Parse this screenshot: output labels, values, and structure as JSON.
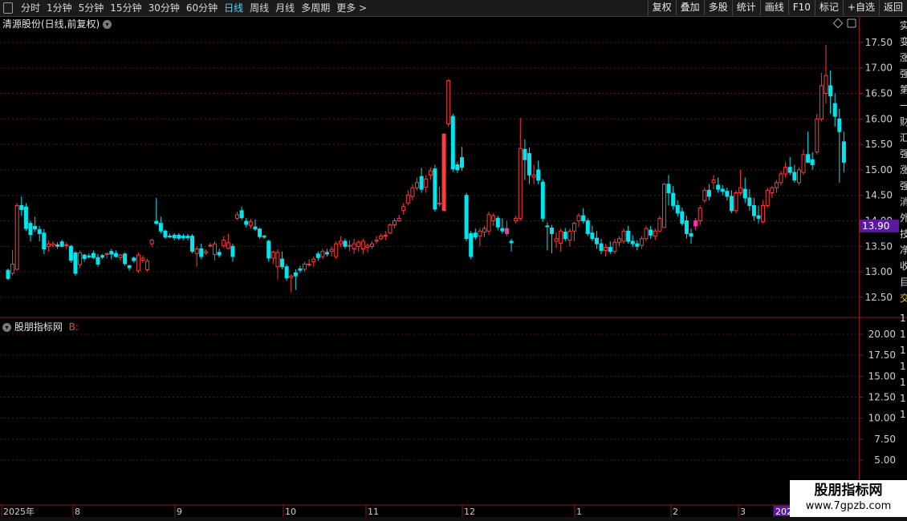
{
  "toolbar": {
    "periods": [
      "分时",
      "1分钟",
      "5分钟",
      "15分钟",
      "30分钟",
      "60分钟",
      "日线",
      "周线",
      "月线",
      "多周期",
      "更多 >"
    ],
    "active_period": "日线",
    "right_buttons": [
      "复权",
      "叠加",
      "多股",
      "统计",
      "画线",
      "F10",
      "标记",
      "+自选",
      "返回"
    ]
  },
  "main_title": "清源股份(日线,前复权)",
  "indicator_title": "股朋指标网",
  "indicator_suffix": "B:",
  "current_price_tag": "13.90",
  "main_axis": [
    "17.50",
    "17.00",
    "16.50",
    "16.00",
    "15.50",
    "15.00",
    "14.50",
    "14.00",
    "13.50",
    "13.00",
    "12.50"
  ],
  "indicator_axis": [
    "20.00",
    "17.50",
    "15.00",
    "12.50",
    "10.00",
    "7.50",
    "5.00"
  ],
  "date_axis": [
    "2025年",
    "8",
    "9",
    "10",
    "11",
    "12",
    "1",
    "2",
    "3",
    "202"
  ],
  "right_edge_glyphs": [
    "实",
    "变",
    "涨",
    "强",
    "第",
    "一",
    "财",
    "汇",
    "强",
    "涨",
    "强",
    "消",
    "外",
    "技",
    "净",
    "收",
    "目",
    "交",
    "1",
    "1",
    "1",
    "1",
    "1",
    "1",
    "1"
  ],
  "watermark": {
    "line1": "股朋指标网",
    "line2": "www.7gpzb.com"
  },
  "colors": {
    "up": "#ff3a3a",
    "down": "#00e6f0",
    "highlight": "#ff2fa8",
    "grid": "#5a1414",
    "price_tag_bg": "#5a1aa0"
  },
  "chart_data": {
    "type": "candlestick",
    "ylim": [
      12.2,
      17.75
    ],
    "candles": [
      {
        "o": 13.03,
        "h": 13.06,
        "l": 12.83,
        "c": 12.87
      },
      {
        "o": 12.97,
        "h": 13.43,
        "l": 12.93,
        "c": 13.15
      },
      {
        "o": 13.05,
        "h": 14.35,
        "l": 13.03,
        "c": 14.3
      },
      {
        "o": 14.3,
        "h": 14.48,
        "l": 14.1,
        "c": 14.22
      },
      {
        "o": 14.27,
        "h": 14.35,
        "l": 13.8,
        "c": 13.85
      },
      {
        "o": 13.95,
        "h": 14.0,
        "l": 13.6,
        "c": 13.73
      },
      {
        "o": 13.89,
        "h": 14.08,
        "l": 13.78,
        "c": 13.84
      },
      {
        "o": 13.83,
        "h": 13.9,
        "l": 13.6,
        "c": 13.75
      },
      {
        "o": 13.76,
        "h": 13.84,
        "l": 13.35,
        "c": 13.45
      },
      {
        "o": 13.5,
        "h": 13.62,
        "l": 13.4,
        "c": 13.55
      },
      {
        "o": 13.52,
        "h": 13.6,
        "l": 13.48,
        "c": 13.55
      },
      {
        "o": 13.53,
        "h": 13.58,
        "l": 13.45,
        "c": 13.5
      },
      {
        "o": 13.59,
        "h": 13.63,
        "l": 13.48,
        "c": 13.5
      },
      {
        "o": 13.53,
        "h": 13.58,
        "l": 13.45,
        "c": 13.53
      },
      {
        "o": 13.5,
        "h": 13.53,
        "l": 13.18,
        "c": 13.23
      },
      {
        "o": 13.37,
        "h": 13.41,
        "l": 12.92,
        "c": 12.97
      },
      {
        "o": 13.14,
        "h": 13.42,
        "l": 13.07,
        "c": 13.37
      },
      {
        "o": 13.33,
        "h": 13.35,
        "l": 13.2,
        "c": 13.26
      },
      {
        "o": 13.31,
        "h": 13.36,
        "l": 13.27,
        "c": 13.3
      },
      {
        "o": 13.36,
        "h": 13.42,
        "l": 13.25,
        "c": 13.28
      },
      {
        "o": 13.28,
        "h": 13.35,
        "l": 13.1,
        "c": 13.15
      },
      {
        "o": 13.32,
        "h": 13.35,
        "l": 13.25,
        "c": 13.29
      },
      {
        "o": 13.34,
        "h": 13.38,
        "l": 13.26,
        "c": 13.36
      },
      {
        "o": 13.4,
        "h": 13.45,
        "l": 13.25,
        "c": 13.35
      },
      {
        "o": 13.36,
        "h": 13.42,
        "l": 13.28,
        "c": 13.3
      },
      {
        "o": 13.28,
        "h": 13.35,
        "l": 13.22,
        "c": 13.33
      },
      {
        "o": 13.35,
        "h": 13.38,
        "l": 13.12,
        "c": 13.16
      },
      {
        "o": 13.12,
        "h": 13.14,
        "l": 13.02,
        "c": 13.08
      },
      {
        "o": 13.27,
        "h": 13.3,
        "l": 13.18,
        "c": 13.22
      },
      {
        "o": 13.02,
        "h": 13.38,
        "l": 12.98,
        "c": 13.33
      },
      {
        "o": 13.23,
        "h": 13.32,
        "l": 13.18,
        "c": 13.27
      },
      {
        "o": 13.04,
        "h": 13.26,
        "l": 13.0,
        "c": 13.21
      },
      {
        "o": 13.55,
        "h": 13.65,
        "l": 13.48,
        "c": 13.62
      },
      {
        "o": 13.99,
        "h": 14.45,
        "l": 13.92,
        "c": 13.95
      },
      {
        "o": 13.95,
        "h": 14.08,
        "l": 13.75,
        "c": 13.8
      },
      {
        "o": 13.8,
        "h": 13.83,
        "l": 13.65,
        "c": 13.68
      },
      {
        "o": 13.7,
        "h": 13.75,
        "l": 13.66,
        "c": 13.69
      },
      {
        "o": 13.72,
        "h": 13.76,
        "l": 13.62,
        "c": 13.67
      },
      {
        "o": 13.72,
        "h": 13.76,
        "l": 13.62,
        "c": 13.66
      },
      {
        "o": 13.7,
        "h": 13.74,
        "l": 13.62,
        "c": 13.67
      },
      {
        "o": 13.7,
        "h": 13.74,
        "l": 13.62,
        "c": 13.67
      },
      {
        "o": 13.7,
        "h": 13.74,
        "l": 13.36,
        "c": 13.4
      },
      {
        "o": 13.36,
        "h": 13.5,
        "l": 13.1,
        "c": 13.45
      },
      {
        "o": 13.45,
        "h": 13.55,
        "l": 13.25,
        "c": 13.3
      },
      {
        "o": 13.37,
        "h": 13.44,
        "l": 13.33,
        "c": 13.4
      },
      {
        "o": 13.52,
        "h": 13.57,
        "l": 13.48,
        "c": 13.52
      },
      {
        "o": 13.34,
        "h": 13.6,
        "l": 13.22,
        "c": 13.55
      },
      {
        "o": 13.38,
        "h": 13.45,
        "l": 13.28,
        "c": 13.33
      },
      {
        "o": 13.51,
        "h": 13.7,
        "l": 13.47,
        "c": 13.62
      },
      {
        "o": 13.46,
        "h": 13.75,
        "l": 13.44,
        "c": 13.57
      },
      {
        "o": 13.5,
        "h": 13.55,
        "l": 13.2,
        "c": 13.3
      },
      {
        "o": 14.05,
        "h": 14.18,
        "l": 14.02,
        "c": 14.12
      },
      {
        "o": 14.2,
        "h": 14.28,
        "l": 14.02,
        "c": 14.06
      },
      {
        "o": 13.99,
        "h": 14.06,
        "l": 13.87,
        "c": 13.93
      },
      {
        "o": 13.91,
        "h": 14.04,
        "l": 13.85,
        "c": 13.98
      },
      {
        "o": 13.88,
        "h": 14.03,
        "l": 13.8,
        "c": 13.84
      },
      {
        "o": 13.84,
        "h": 13.86,
        "l": 13.65,
        "c": 13.69
      },
      {
        "o": 13.7,
        "h": 13.73,
        "l": 13.65,
        "c": 13.68
      },
      {
        "o": 13.6,
        "h": 13.63,
        "l": 13.2,
        "c": 13.27
      },
      {
        "o": 13.27,
        "h": 13.41,
        "l": 13.16,
        "c": 13.39
      },
      {
        "o": 13.1,
        "h": 13.44,
        "l": 12.85,
        "c": 13.38
      },
      {
        "o": 13.25,
        "h": 13.4,
        "l": 13.05,
        "c": 13.1
      },
      {
        "o": 13.1,
        "h": 13.15,
        "l": 12.82,
        "c": 12.88
      },
      {
        "o": 12.89,
        "h": 12.95,
        "l": 12.6,
        "c": 12.92
      },
      {
        "o": 12.98,
        "h": 13.05,
        "l": 12.65,
        "c": 12.92
      },
      {
        "o": 13.06,
        "h": 13.12,
        "l": 12.98,
        "c": 13.03
      },
      {
        "o": 13.05,
        "h": 13.2,
        "l": 13.0,
        "c": 13.15
      },
      {
        "o": 13.14,
        "h": 13.25,
        "l": 13.1,
        "c": 13.15
      },
      {
        "o": 13.2,
        "h": 13.3,
        "l": 13.1,
        "c": 13.25
      },
      {
        "o": 13.35,
        "h": 13.4,
        "l": 13.22,
        "c": 13.28
      },
      {
        "o": 13.3,
        "h": 13.45,
        "l": 13.25,
        "c": 13.4
      },
      {
        "o": 13.38,
        "h": 13.45,
        "l": 13.3,
        "c": 13.35
      },
      {
        "o": 13.4,
        "h": 13.5,
        "l": 13.3,
        "c": 13.44
      },
      {
        "o": 13.3,
        "h": 13.6,
        "l": 13.25,
        "c": 13.55
      },
      {
        "o": 13.55,
        "h": 13.7,
        "l": 13.48,
        "c": 13.6
      },
      {
        "o": 13.6,
        "h": 13.65,
        "l": 13.45,
        "c": 13.5
      },
      {
        "o": 13.5,
        "h": 13.62,
        "l": 13.4,
        "c": 13.52
      },
      {
        "o": 13.45,
        "h": 13.65,
        "l": 13.35,
        "c": 13.55
      },
      {
        "o": 13.5,
        "h": 13.62,
        "l": 13.4,
        "c": 13.58
      },
      {
        "o": 13.45,
        "h": 13.65,
        "l": 13.35,
        "c": 13.6
      },
      {
        "o": 13.48,
        "h": 13.55,
        "l": 13.38,
        "c": 13.52
      },
      {
        "o": 13.5,
        "h": 13.6,
        "l": 13.45,
        "c": 13.55
      },
      {
        "o": 13.6,
        "h": 13.7,
        "l": 13.55,
        "c": 13.62
      },
      {
        "o": 13.65,
        "h": 13.75,
        "l": 13.62,
        "c": 13.7
      },
      {
        "o": 13.7,
        "h": 13.8,
        "l": 13.62,
        "c": 13.72
      },
      {
        "o": 13.76,
        "h": 13.95,
        "l": 13.74,
        "c": 13.92
      },
      {
        "o": 13.92,
        "h": 14.05,
        "l": 13.85,
        "c": 14.0
      },
      {
        "o": 14.0,
        "h": 14.12,
        "l": 13.98,
        "c": 14.05
      },
      {
        "o": 14.2,
        "h": 14.35,
        "l": 14.12,
        "c": 14.28
      },
      {
        "o": 14.35,
        "h": 14.6,
        "l": 14.3,
        "c": 14.5
      },
      {
        "o": 14.48,
        "h": 14.72,
        "l": 14.4,
        "c": 14.65
      },
      {
        "o": 14.65,
        "h": 14.85,
        "l": 14.6,
        "c": 14.75
      },
      {
        "o": 14.87,
        "h": 15.04,
        "l": 14.55,
        "c": 14.62
      },
      {
        "o": 14.66,
        "h": 14.9,
        "l": 14.55,
        "c": 14.82
      },
      {
        "o": 14.9,
        "h": 15.05,
        "l": 14.8,
        "c": 14.98
      },
      {
        "o": 15.02,
        "h": 15.1,
        "l": 14.18,
        "c": 14.23
      },
      {
        "o": 14.33,
        "h": 14.67,
        "l": 14.28,
        "c": 14.35
      },
      {
        "o": 14.2,
        "h": 15.72,
        "l": 14.2,
        "c": 15.7
      },
      {
        "o": 15.9,
        "h": 16.78,
        "l": 15.85,
        "c": 16.75
      },
      {
        "o": 16.05,
        "h": 16.1,
        "l": 14.96,
        "c": 15.02
      },
      {
        "o": 15.1,
        "h": 15.16,
        "l": 14.94,
        "c": 15.0
      },
      {
        "o": 15.24,
        "h": 15.45,
        "l": 14.98,
        "c": 15.05
      },
      {
        "o": 14.5,
        "h": 14.55,
        "l": 13.6,
        "c": 13.65
      },
      {
        "o": 13.75,
        "h": 13.8,
        "l": 13.25,
        "c": 13.3
      },
      {
        "o": 13.76,
        "h": 13.85,
        "l": 13.63,
        "c": 13.68
      },
      {
        "o": 13.7,
        "h": 13.86,
        "l": 13.5,
        "c": 13.8
      },
      {
        "o": 13.78,
        "h": 13.9,
        "l": 13.68,
        "c": 13.85
      },
      {
        "o": 13.8,
        "h": 14.18,
        "l": 13.72,
        "c": 14.12
      },
      {
        "o": 14.0,
        "h": 14.15,
        "l": 13.9,
        "c": 14.1
      },
      {
        "o": 14.05,
        "h": 14.1,
        "l": 13.82,
        "c": 13.88
      },
      {
        "o": 13.85,
        "h": 14.05,
        "l": 13.75,
        "c": 13.8
      },
      {
        "o": 13.85,
        "h": 14.0,
        "l": 13.7,
        "c": 13.75
      },
      {
        "o": 13.6,
        "h": 13.65,
        "l": 13.4,
        "c": 13.57
      },
      {
        "o": 14.0,
        "h": 14.1,
        "l": 13.95,
        "c": 14.05
      },
      {
        "o": 14.05,
        "h": 16.02,
        "l": 14.0,
        "c": 15.42
      },
      {
        "o": 15.4,
        "h": 15.6,
        "l": 14.8,
        "c": 15.2
      },
      {
        "o": 15.32,
        "h": 15.44,
        "l": 14.72,
        "c": 14.9
      },
      {
        "o": 14.86,
        "h": 15.1,
        "l": 14.72,
        "c": 14.9
      },
      {
        "o": 15.0,
        "h": 15.18,
        "l": 14.72,
        "c": 14.8
      },
      {
        "o": 14.76,
        "h": 14.82,
        "l": 13.98,
        "c": 14.05
      },
      {
        "o": 13.9,
        "h": 13.97,
        "l": 13.42,
        "c": 13.89
      },
      {
        "o": 13.86,
        "h": 13.92,
        "l": 13.36,
        "c": 13.75
      },
      {
        "o": 13.6,
        "h": 13.78,
        "l": 13.47,
        "c": 13.65
      },
      {
        "o": 13.56,
        "h": 13.85,
        "l": 13.4,
        "c": 13.8
      },
      {
        "o": 13.78,
        "h": 13.86,
        "l": 13.6,
        "c": 13.65
      },
      {
        "o": 13.62,
        "h": 13.85,
        "l": 13.5,
        "c": 13.8
      },
      {
        "o": 13.8,
        "h": 13.98,
        "l": 13.6,
        "c": 13.95
      },
      {
        "o": 14.0,
        "h": 14.15,
        "l": 13.88,
        "c": 14.1
      },
      {
        "o": 14.1,
        "h": 14.25,
        "l": 13.95,
        "c": 14.0
      },
      {
        "o": 14.0,
        "h": 14.05,
        "l": 13.7,
        "c": 13.75
      },
      {
        "o": 13.76,
        "h": 13.9,
        "l": 13.6,
        "c": 13.65
      },
      {
        "o": 13.66,
        "h": 13.8,
        "l": 13.45,
        "c": 13.55
      },
      {
        "o": 13.55,
        "h": 13.65,
        "l": 13.35,
        "c": 13.42
      },
      {
        "o": 13.42,
        "h": 13.55,
        "l": 13.3,
        "c": 13.48
      },
      {
        "o": 13.48,
        "h": 13.6,
        "l": 13.35,
        "c": 13.4
      },
      {
        "o": 13.4,
        "h": 13.65,
        "l": 13.35,
        "c": 13.58
      },
      {
        "o": 13.58,
        "h": 13.7,
        "l": 13.5,
        "c": 13.65
      },
      {
        "o": 13.6,
        "h": 13.85,
        "l": 13.55,
        "c": 13.8
      },
      {
        "o": 13.8,
        "h": 13.9,
        "l": 13.55,
        "c": 13.6
      },
      {
        "o": 13.6,
        "h": 13.72,
        "l": 13.48,
        "c": 13.55
      },
      {
        "o": 13.55,
        "h": 13.62,
        "l": 13.42,
        "c": 13.5
      },
      {
        "o": 13.52,
        "h": 13.7,
        "l": 13.45,
        "c": 13.65
      },
      {
        "o": 13.65,
        "h": 13.9,
        "l": 13.6,
        "c": 13.85
      },
      {
        "o": 13.82,
        "h": 13.9,
        "l": 13.65,
        "c": 13.72
      },
      {
        "o": 13.7,
        "h": 13.85,
        "l": 13.62,
        "c": 13.8
      },
      {
        "o": 13.8,
        "h": 14.1,
        "l": 13.78,
        "c": 14.05
      },
      {
        "o": 13.87,
        "h": 14.74,
        "l": 13.87,
        "c": 14.72
      },
      {
        "o": 14.72,
        "h": 14.9,
        "l": 14.3,
        "c": 14.55
      },
      {
        "o": 14.54,
        "h": 14.68,
        "l": 14.22,
        "c": 14.3
      },
      {
        "o": 14.3,
        "h": 14.4,
        "l": 14.08,
        "c": 14.15
      },
      {
        "o": 14.18,
        "h": 14.26,
        "l": 13.9,
        "c": 13.95
      },
      {
        "o": 14.0,
        "h": 14.1,
        "l": 13.65,
        "c": 13.75
      },
      {
        "o": 13.75,
        "h": 13.85,
        "l": 13.55,
        "c": 13.7
      },
      {
        "o": 13.9,
        "h": 14.05,
        "l": 13.82,
        "c": 14.0
      },
      {
        "o": 14.0,
        "h": 14.3,
        "l": 13.92,
        "c": 14.25
      },
      {
        "o": 14.4,
        "h": 14.65,
        "l": 14.35,
        "c": 14.6
      },
      {
        "o": 14.6,
        "h": 14.72,
        "l": 14.4,
        "c": 14.48
      },
      {
        "o": 14.75,
        "h": 14.9,
        "l": 14.62,
        "c": 14.8
      },
      {
        "o": 14.7,
        "h": 14.85,
        "l": 14.55,
        "c": 14.62
      },
      {
        "o": 14.62,
        "h": 14.7,
        "l": 14.5,
        "c": 14.58
      },
      {
        "o": 14.58,
        "h": 14.65,
        "l": 14.4,
        "c": 14.48
      },
      {
        "o": 14.48,
        "h": 14.6,
        "l": 14.15,
        "c": 14.2
      },
      {
        "o": 14.2,
        "h": 14.6,
        "l": 14.15,
        "c": 14.55
      },
      {
        "o": 14.55,
        "h": 15.0,
        "l": 14.5,
        "c": 14.65
      },
      {
        "o": 14.62,
        "h": 14.85,
        "l": 14.35,
        "c": 14.45
      },
      {
        "o": 14.45,
        "h": 14.62,
        "l": 14.2,
        "c": 14.3
      },
      {
        "o": 14.3,
        "h": 14.45,
        "l": 14.0,
        "c": 14.1
      },
      {
        "o": 14.1,
        "h": 14.3,
        "l": 13.95,
        "c": 14.05
      },
      {
        "o": 13.98,
        "h": 14.4,
        "l": 13.95,
        "c": 14.3
      },
      {
        "o": 14.3,
        "h": 14.65,
        "l": 14.25,
        "c": 14.6
      },
      {
        "o": 14.55,
        "h": 14.68,
        "l": 14.45,
        "c": 14.65
      },
      {
        "o": 14.65,
        "h": 14.8,
        "l": 14.55,
        "c": 14.75
      },
      {
        "o": 14.75,
        "h": 14.98,
        "l": 14.7,
        "c": 14.92
      },
      {
        "o": 14.92,
        "h": 15.15,
        "l": 14.85,
        "c": 15.05
      },
      {
        "o": 15.05,
        "h": 15.25,
        "l": 14.9,
        "c": 14.95
      },
      {
        "o": 14.95,
        "h": 15.1,
        "l": 14.75,
        "c": 14.8
      },
      {
        "o": 14.75,
        "h": 15.05,
        "l": 14.7,
        "c": 15.0
      },
      {
        "o": 14.95,
        "h": 15.4,
        "l": 14.9,
        "c": 15.3
      },
      {
        "o": 15.3,
        "h": 15.75,
        "l": 15.2,
        "c": 15.15
      },
      {
        "o": 15.2,
        "h": 15.35,
        "l": 15.0,
        "c": 15.1
      },
      {
        "o": 15.35,
        "h": 16.1,
        "l": 15.3,
        "c": 16.0
      },
      {
        "o": 16.0,
        "h": 16.9,
        "l": 15.95,
        "c": 16.65
      },
      {
        "o": 16.5,
        "h": 17.45,
        "l": 16.3,
        "c": 16.85
      },
      {
        "o": 16.65,
        "h": 16.95,
        "l": 16.1,
        "c": 16.45
      },
      {
        "o": 16.3,
        "h": 16.5,
        "l": 15.85,
        "c": 16.05
      },
      {
        "o": 16.0,
        "h": 16.2,
        "l": 14.75,
        "c": 15.75
      },
      {
        "o": 15.55,
        "h": 15.75,
        "l": 14.95,
        "c": 15.15
      }
    ]
  }
}
